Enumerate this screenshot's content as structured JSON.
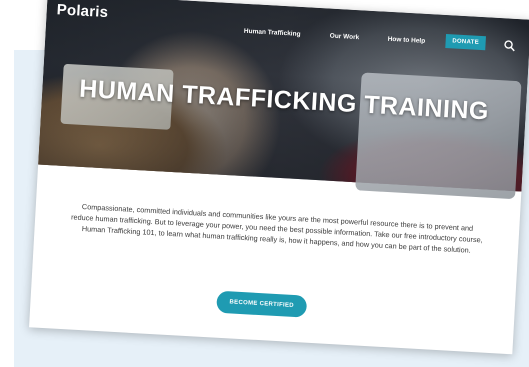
{
  "site": {
    "logo_text": "Polaris"
  },
  "nav": {
    "links": [
      "Human Trafficking",
      "Our Work",
      "How to Help"
    ],
    "donate_label": "DONATE",
    "search_icon": "search-icon"
  },
  "hero": {
    "title": "HUMAN TRAFFICKING TRAINING"
  },
  "content": {
    "paragraph": "Compassionate, committed individuals and communities like yours are the most powerful resource there is to prevent and reduce human trafficking. But to leverage your power, you need the best possible information. Take our free introductory course, Human Trafficking 101, to learn what human trafficking really is, how it happens, and how you can be part of the solution.",
    "cta_label": "BECOME CERTIFIED"
  },
  "colors": {
    "accent": "#1f9bb2",
    "backdrop": "#e6f0f8"
  }
}
